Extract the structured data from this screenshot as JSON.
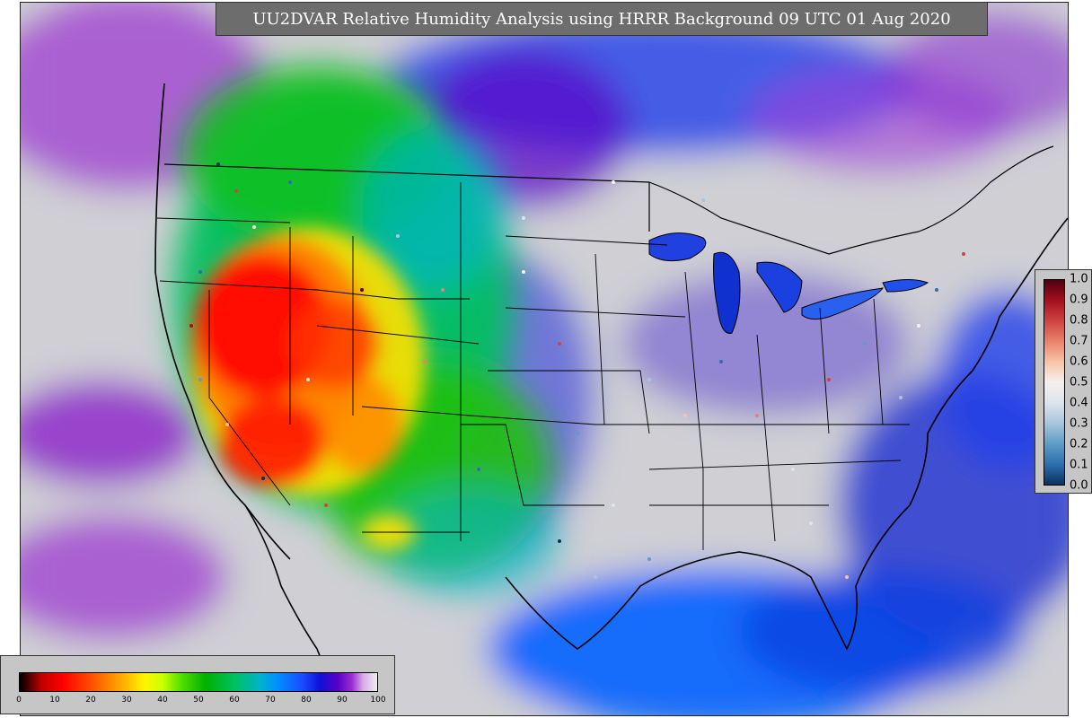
{
  "map": {
    "title": "UU2DVAR Relative Humidity Analysis using HRRR Background 09 UTC 01 Aug 2020",
    "variable": "Relative Humidity",
    "region": "Contiguous United States"
  },
  "rh_colorbar": {
    "ticks": [
      "0",
      "10",
      "20",
      "30",
      "40",
      "50",
      "60",
      "70",
      "80",
      "90",
      "100"
    ],
    "colors": [
      "#000000",
      "#c00000",
      "#ff0000",
      "#ff7a00",
      "#ffe000",
      "#c8ff00",
      "#00b000",
      "#00b4c8",
      "#1a4cff",
      "#5a00c8",
      "#eeeeee"
    ]
  },
  "obs_colorbar": {
    "ticks": [
      "1.0",
      "0.9",
      "0.8",
      "0.7",
      "0.6",
      "0.5",
      "0.4",
      "0.3",
      "0.2",
      "0.1",
      "0.0"
    ],
    "colors": [
      "#4d0010",
      "#a3101e",
      "#cf4343",
      "#e9826b",
      "#f8c4a6",
      "#f6f0ee",
      "#dce4ec",
      "#a8c6dd",
      "#5f9cc6",
      "#2d6fae",
      "#0b305f"
    ]
  }
}
